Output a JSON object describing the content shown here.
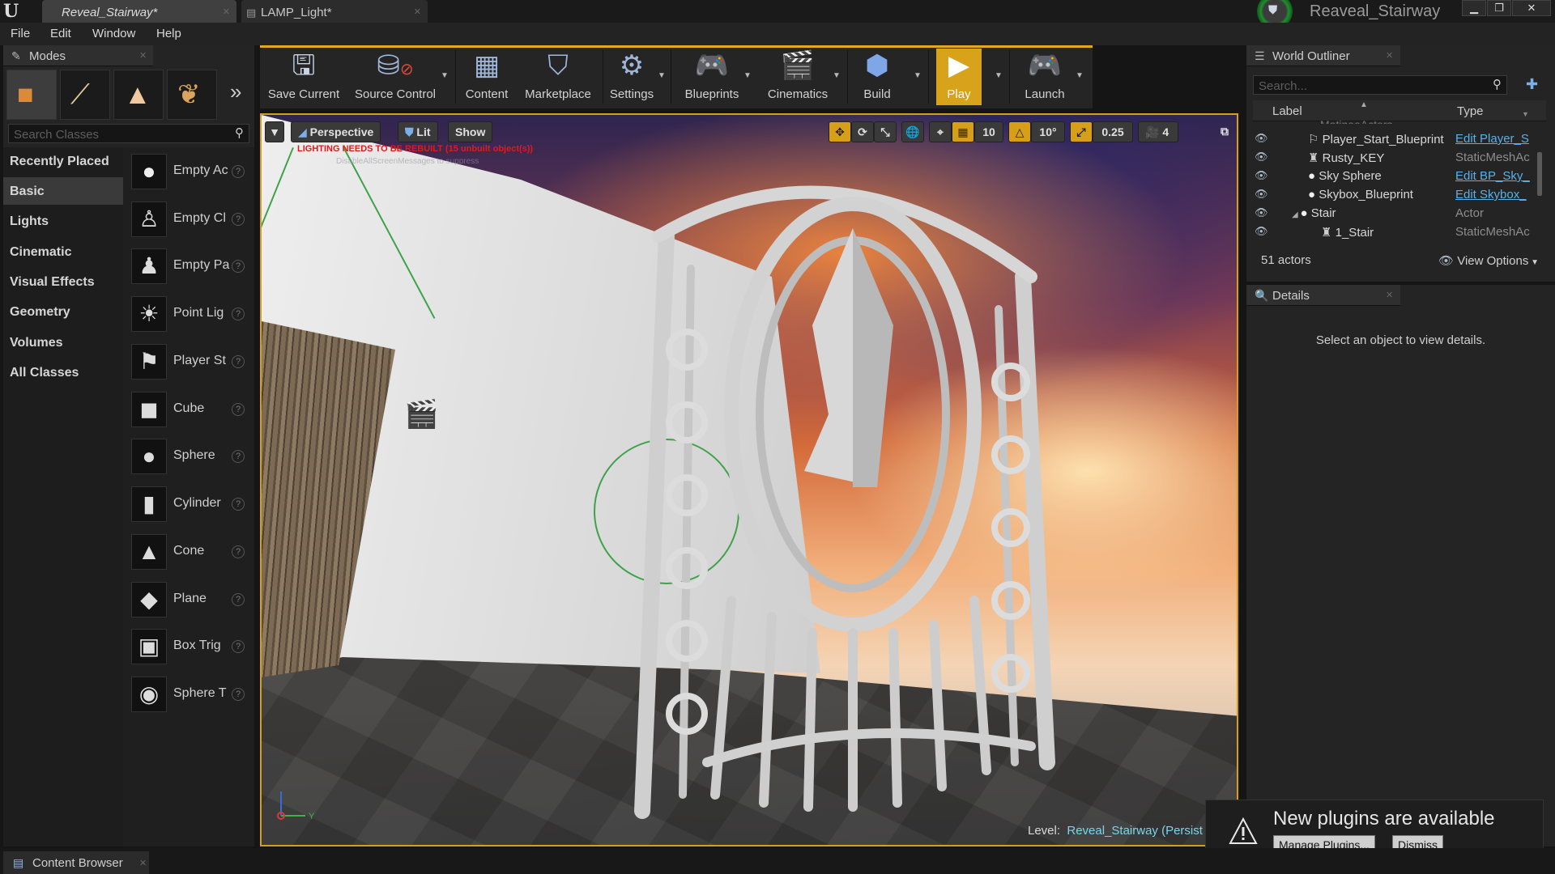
{
  "titlebar": {
    "tabs": [
      {
        "label": "Reveal_Stairway*",
        "active": true
      },
      {
        "label": "LAMP_Light*",
        "active": false
      }
    ],
    "project_name": "Reaveal_Stairway",
    "window_buttons": [
      "minimize",
      "restore",
      "close"
    ]
  },
  "menu": [
    "File",
    "Edit",
    "Window",
    "Help"
  ],
  "modes": {
    "title": "Modes",
    "tools": [
      "place-icon",
      "paint-icon",
      "landscape-icon",
      "foliage-icon"
    ],
    "search_placeholder": "Search Classes",
    "categories": [
      "Recently Placed",
      "Basic",
      "Lights",
      "Cinematic",
      "Visual Effects",
      "Geometry",
      "Volumes",
      "All Classes"
    ],
    "active_category": "Basic",
    "items": [
      {
        "label": "Empty Ac",
        "icon": "empty-actor-icon"
      },
      {
        "label": "Empty Cl",
        "icon": "empty-character-icon"
      },
      {
        "label": "Empty Pa",
        "icon": "empty-pawn-icon"
      },
      {
        "label": "Point Lig",
        "icon": "point-light-icon"
      },
      {
        "label": "Player St",
        "icon": "player-start-icon"
      },
      {
        "label": "Cube",
        "icon": "cube-icon"
      },
      {
        "label": "Sphere",
        "icon": "sphere-icon"
      },
      {
        "label": "Cylinder",
        "icon": "cylinder-icon"
      },
      {
        "label": "Cone",
        "icon": "cone-icon"
      },
      {
        "label": "Plane",
        "icon": "plane-icon"
      },
      {
        "label": "Box Trig",
        "icon": "box-trigger-icon"
      },
      {
        "label": "Sphere T",
        "icon": "sphere-trigger-icon"
      }
    ]
  },
  "toolbar": {
    "buttons": [
      {
        "label": "Save Current",
        "icon": "save-icon"
      },
      {
        "label": "Source Control",
        "icon": "source-control-icon"
      },
      {
        "label": "Content",
        "icon": "content-icon"
      },
      {
        "label": "Marketplace",
        "icon": "marketplace-icon"
      },
      {
        "label": "Settings",
        "icon": "settings-icon"
      },
      {
        "label": "Blueprints",
        "icon": "blueprints-icon"
      },
      {
        "label": "Cinematics",
        "icon": "cinematics-icon"
      },
      {
        "label": "Build",
        "icon": "build-icon"
      },
      {
        "label": "Play",
        "icon": "play-icon"
      },
      {
        "label": "Launch",
        "icon": "launch-icon"
      }
    ],
    "accent_color": "#d8a21a"
  },
  "viewport": {
    "view_mode": "Perspective",
    "lit": "Lit",
    "show": "Show",
    "grid_snap": "10",
    "rotation_snap": "10°",
    "scale_snap": "0.25",
    "camera_speed": "4",
    "warning": "LIGHTING NEEDS TO BE REBUILT (15 unbuilt object(s))",
    "warning_sub": "DisableAllScreenMessages to suppress",
    "level_label": "Level:",
    "level_name": "Reveal_Stairway (Persist"
  },
  "outliner": {
    "title": "World Outliner",
    "search_placeholder": "Search...",
    "col_label": "Label",
    "col_type": "Type",
    "partial_row": "MatineeActors",
    "rows": [
      {
        "label": "Player_Start_Blueprint",
        "type": "Edit Player_S",
        "link": true,
        "indent": 1
      },
      {
        "label": "Rusty_KEY",
        "type": "StaticMeshAc",
        "link": false,
        "indent": 1
      },
      {
        "label": "Sky Sphere",
        "type": "Edit BP_Sky_",
        "link": true,
        "indent": 1
      },
      {
        "label": "Skybox_Blueprint",
        "type": "Edit Skybox_",
        "link": true,
        "indent": 1
      },
      {
        "label": "Stair",
        "type": "Actor",
        "link": false,
        "indent": 1
      },
      {
        "label": "1_Stair",
        "type": "StaticMeshAc",
        "link": false,
        "indent": 2
      }
    ],
    "count": "51 actors",
    "view_options": "View Options"
  },
  "details": {
    "title": "Details",
    "empty": "Select an object to view details."
  },
  "notification": {
    "title": "New plugins are available",
    "manage": "Manage Plugins...",
    "dismiss": "Dismiss"
  },
  "bottom": {
    "content_browser": "Content Browser"
  }
}
